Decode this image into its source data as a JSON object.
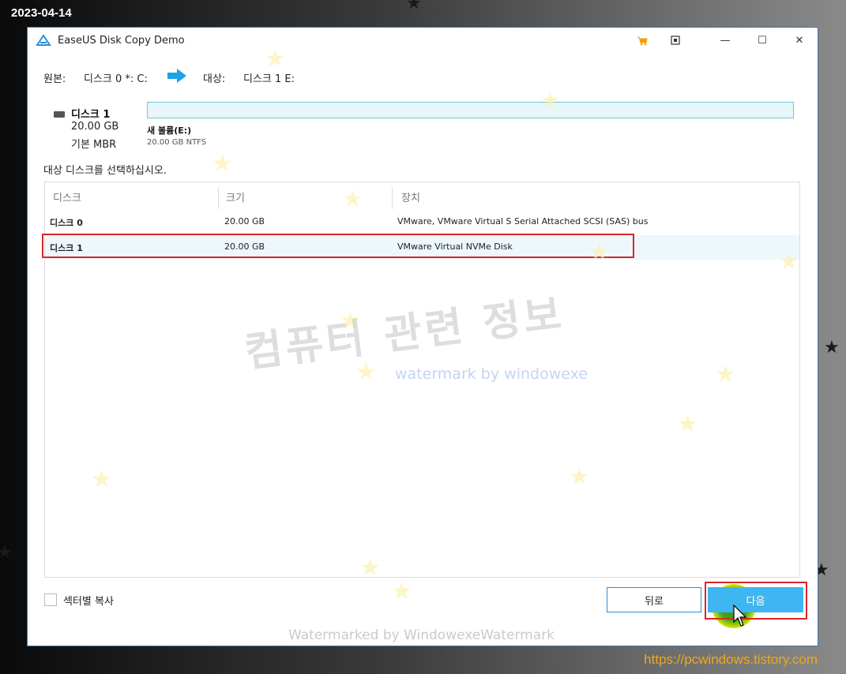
{
  "overlay": {
    "date": "2023-04-14",
    "site": "https://pcwindows.tistory.com"
  },
  "window": {
    "title": "EaseUS Disk Copy Demo",
    "controls": {
      "cart_icon": "cart-icon",
      "pin_icon": "pin-icon",
      "minimize": "—",
      "maximize": "☐",
      "close": "✕"
    }
  },
  "source": {
    "label": "원본:",
    "value": "디스크 0 *: C:",
    "target_label": "대상:",
    "target_value": "디스크 1 E:"
  },
  "target_disk": {
    "name": "디스크 1",
    "size": "20.00 GB",
    "type": "기본 MBR",
    "partition_name": "새 볼륨(E:)",
    "partition_size": "20.00 GB NTFS"
  },
  "prompt": "대상 디스크를 선택하십시오.",
  "table": {
    "headers": [
      "디스크",
      "크기",
      "장치"
    ],
    "rows": [
      {
        "disk": "디스크 0",
        "size": "20.00 GB",
        "device": "VMware,  VMware Virtual S Serial Attached SCSI (SAS) bus",
        "selected": false
      },
      {
        "disk": "디스크 1",
        "size": "20.00 GB",
        "device": "VMware Virtual NVMe Disk",
        "selected": true
      }
    ]
  },
  "sector_copy": {
    "label": "섹터별 복사",
    "checked": false
  },
  "buttons": {
    "back": "뒤로",
    "next": "다음"
  },
  "watermarks": {
    "korean": "컴퓨터 관련 정보",
    "english": "watermark by windowexe",
    "bottom": "Watermarked by WindowexeWatermark"
  },
  "colors": {
    "accent": "#3fb6f1",
    "highlight": "#d9262b",
    "cart": "#f2a000"
  }
}
